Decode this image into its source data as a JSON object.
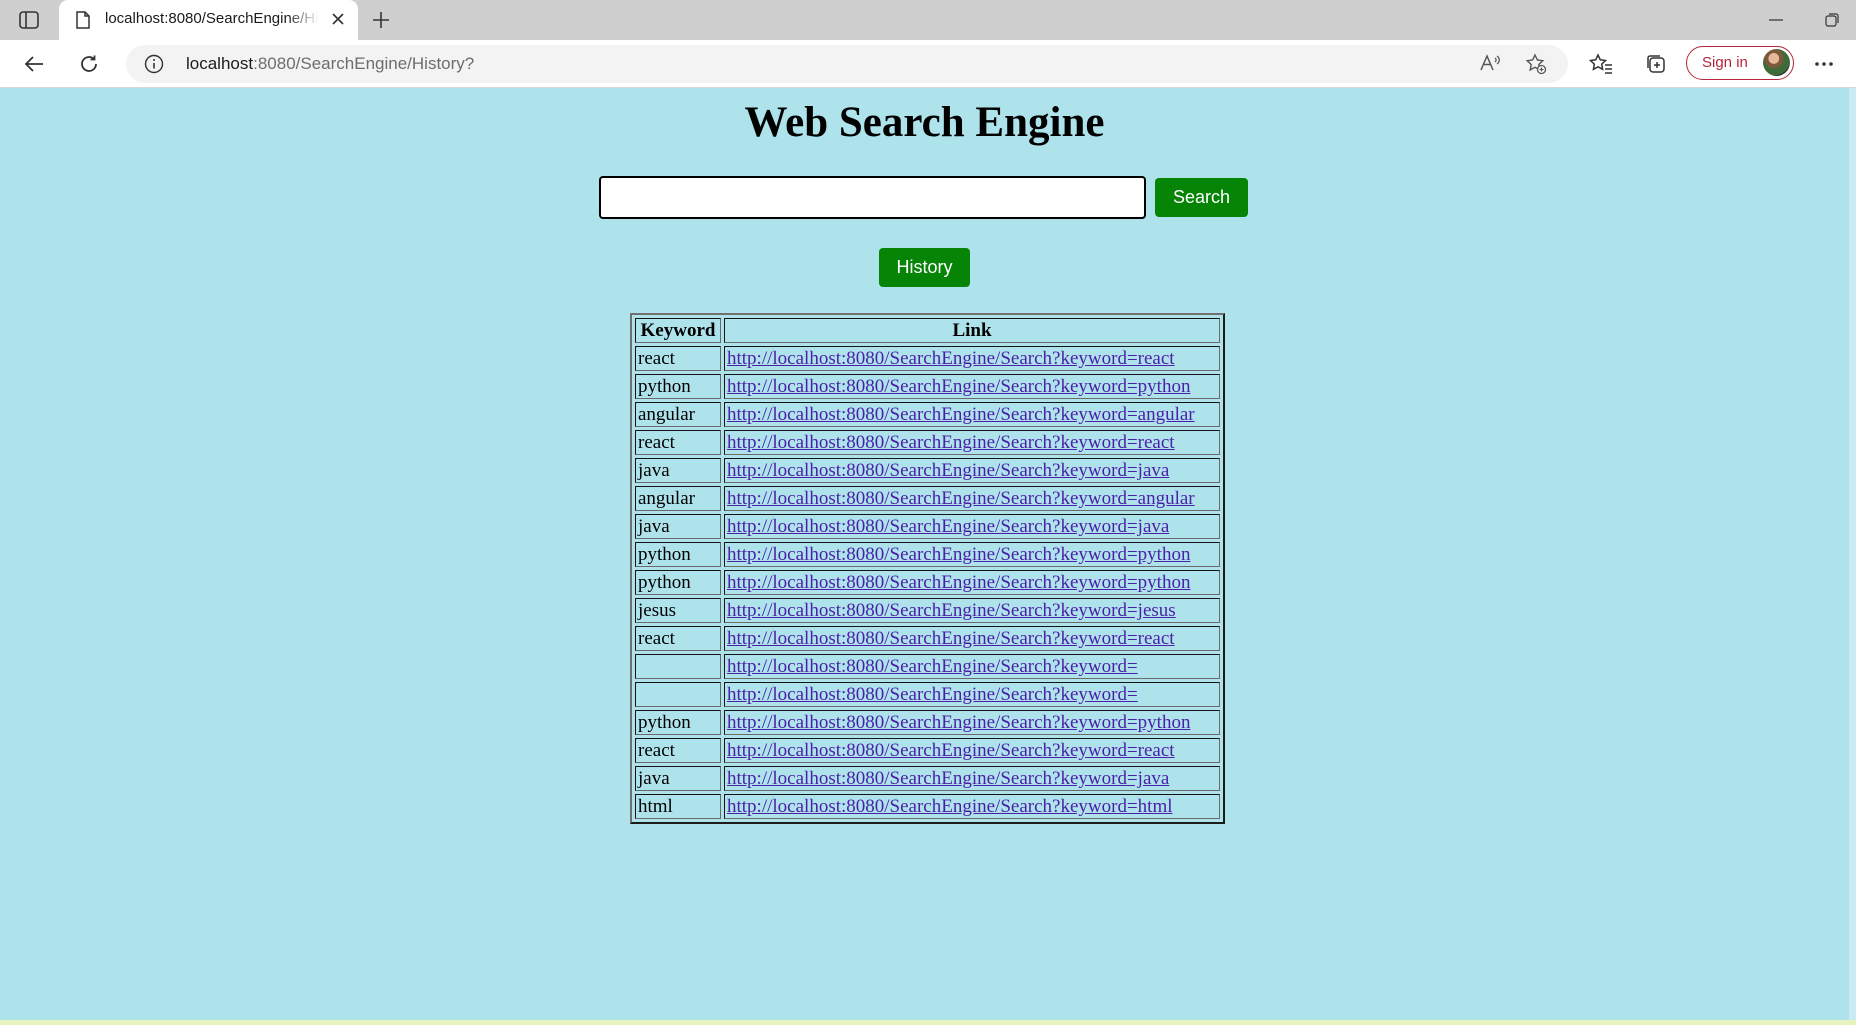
{
  "browser": {
    "tab_title": "localhost:8080/SearchEngine/History?",
    "url_host": "localhost",
    "url_rest": ":8080/SearchEngine/History?",
    "signin_label": "Sign in"
  },
  "page": {
    "title": "Web Search Engine",
    "search_placeholder": "",
    "search_button": "Search",
    "history_button": "History"
  },
  "table": {
    "headers": [
      "Keyword",
      "Link"
    ],
    "rows": [
      {
        "keyword": "react",
        "link": "http://localhost:8080/SearchEngine/Search?keyword=react"
      },
      {
        "keyword": "python",
        "link": "http://localhost:8080/SearchEngine/Search?keyword=python"
      },
      {
        "keyword": "angular",
        "link": "http://localhost:8080/SearchEngine/Search?keyword=angular"
      },
      {
        "keyword": "react",
        "link": "http://localhost:8080/SearchEngine/Search?keyword=react"
      },
      {
        "keyword": "java",
        "link": "http://localhost:8080/SearchEngine/Search?keyword=java"
      },
      {
        "keyword": "angular",
        "link": "http://localhost:8080/SearchEngine/Search?keyword=angular"
      },
      {
        "keyword": "java",
        "link": "http://localhost:8080/SearchEngine/Search?keyword=java"
      },
      {
        "keyword": "python",
        "link": "http://localhost:8080/SearchEngine/Search?keyword=python"
      },
      {
        "keyword": "python",
        "link": "http://localhost:8080/SearchEngine/Search?keyword=python"
      },
      {
        "keyword": "jesus",
        "link": "http://localhost:8080/SearchEngine/Search?keyword=jesus"
      },
      {
        "keyword": "react",
        "link": "http://localhost:8080/SearchEngine/Search?keyword=react"
      },
      {
        "keyword": "",
        "link": "http://localhost:8080/SearchEngine/Search?keyword="
      },
      {
        "keyword": "",
        "link": "http://localhost:8080/SearchEngine/Search?keyword="
      },
      {
        "keyword": "python",
        "link": "http://localhost:8080/SearchEngine/Search?keyword=python"
      },
      {
        "keyword": "react",
        "link": "http://localhost:8080/SearchEngine/Search?keyword=react"
      },
      {
        "keyword": "java",
        "link": "http://localhost:8080/SearchEngine/Search?keyword=java"
      },
      {
        "keyword": "html",
        "link": "http://localhost:8080/SearchEngine/Search?keyword=html"
      }
    ]
  },
  "colors": {
    "page_background": "#aee3ec",
    "button_green": "#068406",
    "link_color": "#4b1fa8",
    "signin_accent": "#b3263c"
  }
}
